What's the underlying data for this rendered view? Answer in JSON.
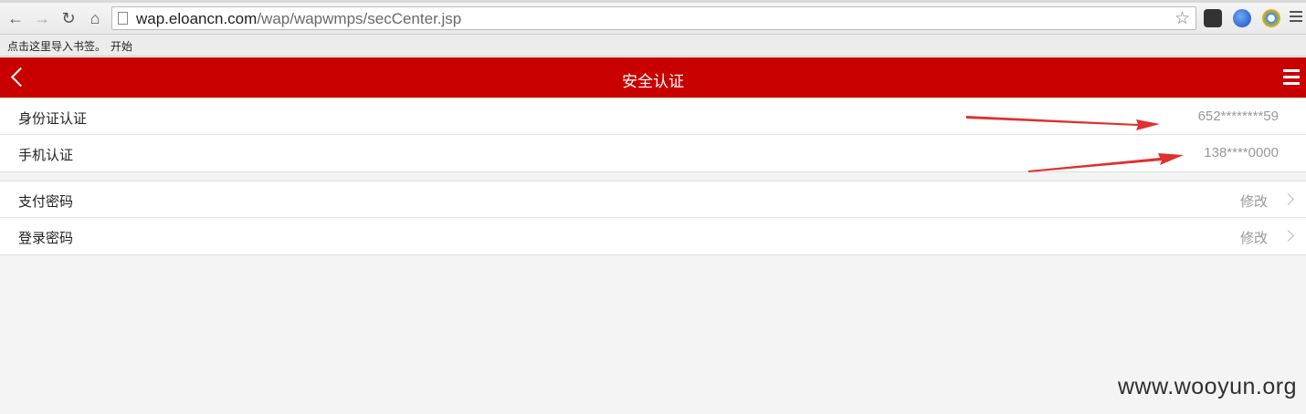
{
  "browser": {
    "url_host": "wap.eloancn.com",
    "url_path": "/wap/wapwmps/secCenter.jsp",
    "bookmarks_hint": "点击这里导入书签。",
    "bookmarks_start": "开始"
  },
  "header": {
    "title": "安全认证"
  },
  "verification": [
    {
      "label": "身份证认证",
      "value": "652********59"
    },
    {
      "label": "手机认证",
      "value": "138****0000"
    }
  ],
  "passwords": [
    {
      "label": "支付密码",
      "action": "修改"
    },
    {
      "label": "登录密码",
      "action": "修改"
    }
  ],
  "annotation_color": "#e03030",
  "header_color": "#c90000",
  "watermark": "www.wooyun.org"
}
